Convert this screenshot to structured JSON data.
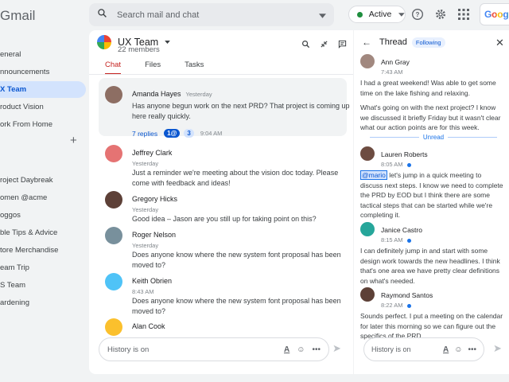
{
  "app": {
    "brand": "Gmail"
  },
  "search": {
    "placeholder": "Search mail and chat"
  },
  "status": {
    "label": "Active",
    "color": "#1e8e3e"
  },
  "google": {
    "label": "Google"
  },
  "sidebar": {
    "items": [
      "eneral",
      "nnouncements",
      "X Team",
      "roduct Vision",
      "ork From Home"
    ],
    "active_index": 2,
    "items2": [
      "roject Daybreak",
      "omen @acme",
      "oggos",
      "ble Tips & Advice",
      "tore Merchandise",
      "eam Trip",
      "S Team",
      "ardening"
    ]
  },
  "room": {
    "title": "UX Team",
    "members": "22 members",
    "tabs": [
      "Chat",
      "Files",
      "Tasks"
    ]
  },
  "messages": [
    {
      "name": "Amanda Hayes",
      "time": "Yesterday",
      "text": "Has anyone begun work on the next PRD? That project is coming up here really quickly.",
      "replies": "7 replies",
      "chip1": "1@",
      "chip2": "3",
      "reply_time": "9:04 AM",
      "avatar_color": "#8d6e63"
    },
    {
      "name": "Jeffrey Clark",
      "time": "Yesterday",
      "text": "Just a reminder we're meeting about the vision doc today. Please come with feedback and ideas!",
      "avatar_color": "#e57373"
    },
    {
      "name": "Gregory Hicks",
      "time": "Yesterday",
      "text": "Good idea – Jason are you still up for taking point on this?",
      "avatar_color": "#5d4037"
    },
    {
      "name": "Roger Nelson",
      "time": "Yesterday",
      "text": "Does anyone know where the new system font proposal has been moved to?",
      "avatar_color": "#78909c"
    },
    {
      "name": "Keith Obrien",
      "time": "8:43 AM",
      "text": "Does anyone know where the new system font proposal has been moved to?",
      "avatar_color": "#4fc3f7"
    },
    {
      "name": "Alan Cook",
      "avatar_color": "#fbc02d"
    }
  ],
  "composer": {
    "placeholder": "History is on"
  },
  "thread": {
    "title": "Thread",
    "following": "Following",
    "unread_label": "Unread",
    "messages": [
      {
        "name": "Ann Gray",
        "time": "7:43 AM",
        "text": "I had a great weekend! Was able to get some time on the lake fishing and relaxing.",
        "text2": "What's going on with the next project? I know we discussed it briefly Friday but it wasn't clear what our action points are for this week.",
        "avatar_color": "#a1887f"
      },
      {
        "name": "Lauren Roberts",
        "time": "8:05 AM",
        "mention": "@mario",
        "text": " let's jump in a quick meeting to discuss next steps. I know we need to complete the PRD by EOD but I think there are some tactical steps that can be started while we're completing it.",
        "avatar_color": "#6d4c41"
      },
      {
        "name": "Janice Castro",
        "time": "8:15 AM",
        "text": "I can definitely jump in and start with some design work towards the new headlines. I think that's one area we have pretty clear definitions on what's needed.",
        "avatar_color": "#26a69a"
      },
      {
        "name": "Raymond Santos",
        "time": "8:22 AM",
        "text": "Sounds perfect. I put a meeting on the calendar for later this morning so we can figure out the specifics of the PRD.",
        "avatar_color": "#5d4037"
      }
    ]
  },
  "colors": {
    "accent": "#0b57d0",
    "tab_active": "#c5221f"
  }
}
